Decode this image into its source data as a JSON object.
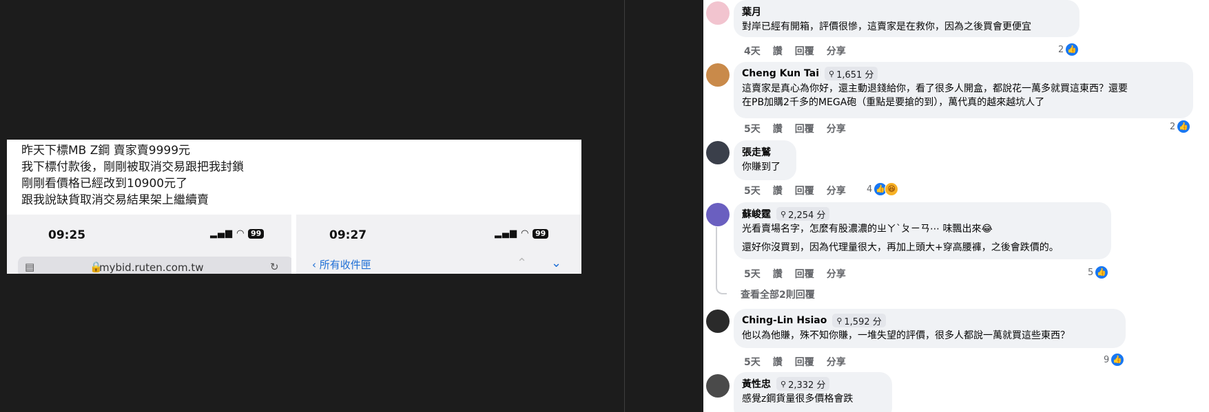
{
  "post_image": {
    "caption_lines": [
      "昨天下標MB Z鋼 賣家賣9999元",
      "我下標付款後，剛剛被取消交易跟把我封鎖",
      "剛剛看價格已經改到10900元了",
      "跟我說缺貨取消交易結果架上繼續賣"
    ],
    "left_phone": {
      "time": "09:25",
      "battery": "99",
      "url": "mybid.ruten.com.tw"
    },
    "right_phone": {
      "time": "09:27",
      "battery": "99",
      "back_link": "所有收件匣"
    }
  },
  "comments": [
    {
      "name": "葉月",
      "badge": "",
      "text": [
        "對岸已經有開箱，評價很慘，這賣家是在救你，因為之後買會更便宜"
      ],
      "age": "4天",
      "like_label": "讚",
      "reply_label": "回覆",
      "share_label": "分享",
      "reactions": "2",
      "avatar_color": "#f2c4cf"
    },
    {
      "name": "Cheng Kun Tai",
      "badge": "1,651 分",
      "text": [
        "這賣家是真心為你好，還主動退錢給你，看了很多人開盒，都說花一萬多就買這東西？還要",
        "在PB加購2千多的MEGA砲（重點是要搶的到），萬代真的越來越坑人了"
      ],
      "age": "5天",
      "like_label": "讚",
      "reply_label": "回覆",
      "share_label": "分享",
      "reactions": "2",
      "avatar_color": "#c98a4a"
    },
    {
      "name": "張走鷲",
      "badge": "",
      "text": [
        "你賺到了"
      ],
      "age": "5天",
      "like_label": "讚",
      "reply_label": "回覆",
      "share_label": "分享",
      "reactions": "4",
      "avatar_color": "#3a3f4a"
    },
    {
      "name": "蘇峻霆",
      "badge": "2,254 分",
      "text": [
        "光看賣場名字，怎麼有股濃濃的ㄓㄚˋㄆㄧㄢ⋯ 味飄出來😂",
        "還好你沒買到，因為代理量很大，再加上頭大+穿高腰褲，之後會跌價的。"
      ],
      "age": "5天",
      "like_label": "讚",
      "reply_label": "回覆",
      "share_label": "分享",
      "reactions": "5",
      "avatar_color": "#6a5fc0"
    },
    {
      "name": "Ching-Lin Hsiao",
      "badge": "1,592 分",
      "text": [
        "他以為他賺，殊不知你賺，一堆失望的評價，很多人都說一萬就買這些東西？"
      ],
      "age": "5天",
      "like_label": "讚",
      "reply_label": "回覆",
      "share_label": "分享",
      "reactions": "9",
      "avatar_color": "#2a2a2a"
    },
    {
      "name": "黃性忠",
      "badge": "2,332 分",
      "text": [
        "感覺z鋼貨量很多價格會跌"
      ],
      "age": "",
      "like_label": "",
      "reply_label": "",
      "share_label": "",
      "reactions": "",
      "avatar_color": "#4a4a4a"
    }
  ],
  "view_replies": "查看全部2則回覆",
  "icons": {
    "like": "like-icon",
    "haha": "haha-icon",
    "points": "points-badge-icon"
  }
}
